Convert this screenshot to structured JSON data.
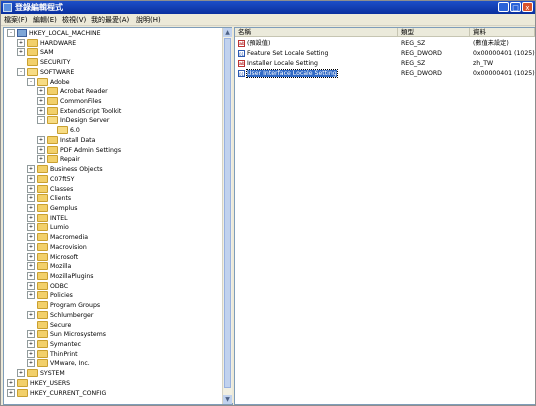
{
  "window": {
    "title": "登錄編輯程式",
    "controls": [
      "_",
      "□",
      "x"
    ]
  },
  "menu": [
    "檔案(F)",
    "編輯(E)",
    "檢視(V)",
    "我的最愛(A)",
    "說明(H)"
  ],
  "tree": [
    {
      "label": "HKEY_LOCAL_MACHINE",
      "expander": "-"
    },
    {
      "label": "HARDWARE",
      "expander": "+"
    },
    {
      "label": "SAM",
      "expander": "+"
    },
    {
      "label": "SECURITY",
      "expander": ""
    },
    {
      "label": "SOFTWARE",
      "expander": "-"
    },
    {
      "label": "Adobe",
      "expander": "-"
    },
    {
      "label": "Acrobat Reader",
      "expander": "+"
    },
    {
      "label": "CommonFiles",
      "expander": "+"
    },
    {
      "label": "ExtendScript Toolkit",
      "expander": "+"
    },
    {
      "label": "InDesign Server",
      "expander": "-"
    },
    {
      "label": "6.0",
      "expander": ""
    },
    {
      "label": "Install Data",
      "expander": "+"
    },
    {
      "label": "PDF Admin Settings",
      "expander": "+"
    },
    {
      "label": "Repair",
      "expander": "+"
    },
    {
      "label": "Business Objects",
      "expander": "+"
    },
    {
      "label": "C07ft5Y",
      "expander": "+"
    },
    {
      "label": "Classes",
      "expander": "+"
    },
    {
      "label": "Clients",
      "expander": "+"
    },
    {
      "label": "Gemplus",
      "expander": "+"
    },
    {
      "label": "INTEL",
      "expander": "+"
    },
    {
      "label": "Lumio",
      "expander": "+"
    },
    {
      "label": "Macromedia",
      "expander": "+"
    },
    {
      "label": "Macrovision",
      "expander": "+"
    },
    {
      "label": "Microsoft",
      "expander": "+"
    },
    {
      "label": "Mozilla",
      "expander": "+"
    },
    {
      "label": "MozillaPlugins",
      "expander": "+"
    },
    {
      "label": "ODBC",
      "expander": "+"
    },
    {
      "label": "Policies",
      "expander": "+"
    },
    {
      "label": "Program Groups",
      "expander": ""
    },
    {
      "label": "Schlumberger",
      "expander": "+"
    },
    {
      "label": "Secure",
      "expander": ""
    },
    {
      "label": "Sun Microsystems",
      "expander": "+"
    },
    {
      "label": "Symantec",
      "expander": "+"
    },
    {
      "label": "ThinPrint",
      "expander": "+"
    },
    {
      "label": "VMware, Inc.",
      "expander": "+"
    },
    {
      "label": "SYSTEM",
      "expander": "+"
    },
    {
      "label": "HKEY_USERS",
      "expander": "+"
    },
    {
      "label": "HKEY_CURRENT_CONFIG",
      "expander": "+"
    }
  ],
  "list": {
    "columns": [
      "名稱",
      "類型",
      "資料"
    ],
    "rows": [
      {
        "name": "(預設值)",
        "type": "REG_SZ",
        "data": "(數值未設定)",
        "icon": "string-value-icon"
      },
      {
        "name": "Feature Set Locale Setting",
        "type": "REG_DWORD",
        "data": "0x00000401 (1025)",
        "icon": "binary-value-icon"
      },
      {
        "name": "Installer Locale Setting",
        "type": "REG_SZ",
        "data": "zh_TW",
        "icon": "string-value-icon"
      },
      {
        "name": "User Interface Locale Setting",
        "type": "REG_DWORD",
        "data": "0x00000401 (1025)",
        "icon": "binary-value-icon",
        "selected": true
      }
    ]
  }
}
